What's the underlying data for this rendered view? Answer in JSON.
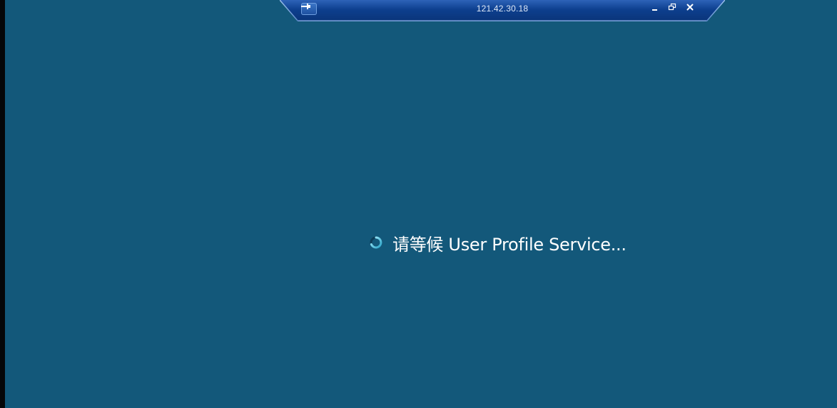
{
  "connection_bar": {
    "title": "121.42.30.18",
    "pin_icon": "pin-icon",
    "minimize_icon": "minimize-icon",
    "restore_icon": "restore-icon",
    "close_icon": "close-icon",
    "bar_color": "#0b3f8a",
    "accent_color": "#3d78c9"
  },
  "desktop": {
    "background_color": "#13587a"
  },
  "loading": {
    "message": "请等候 User Profile Service...",
    "spinner_icon": "loading-spinner-icon",
    "spinner_color": "#5fd0e8"
  }
}
